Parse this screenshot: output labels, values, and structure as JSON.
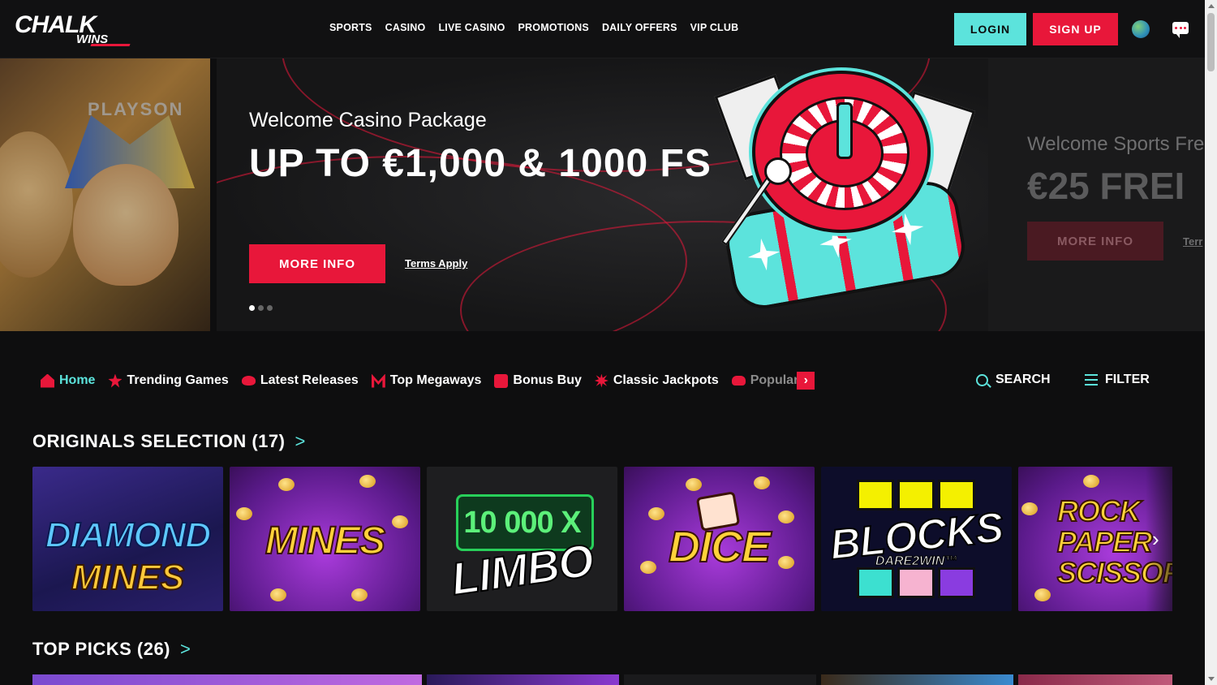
{
  "brand": {
    "logo_main": "CHALK",
    "logo_sub": "WINS"
  },
  "nav": [
    "SPORTS",
    "CASINO",
    "LIVE CASINO",
    "PROMOTIONS",
    "DAILY OFFERS",
    "VIP CLUB"
  ],
  "header": {
    "login": "LOGIN",
    "signup": "SIGN UP"
  },
  "hero_prev": {
    "brand": "PLAYSON"
  },
  "hero": {
    "subtitle": "Welcome Casino Package",
    "headline": "UP TO €1,000 & 1000 FS",
    "button": "MORE INFO",
    "terms": "Terms Apply",
    "slides": 3,
    "active_slide": 1
  },
  "hero_next": {
    "subtitle": "Welcome Sports Fre",
    "headline": "€25 FREI",
    "button": "MORE INFO",
    "terms": "Terr"
  },
  "categories": [
    {
      "label": "Home",
      "icon": "home-icon",
      "active": true
    },
    {
      "label": "Trending Games",
      "icon": "star-icon"
    },
    {
      "label": "Latest Releases",
      "icon": "lips-icon"
    },
    {
      "label": "Top Megaways",
      "icon": "megaways-icon"
    },
    {
      "label": "Bonus Buy",
      "icon": "check-icon"
    },
    {
      "label": "Classic Jackpots",
      "icon": "burst-icon"
    },
    {
      "label": "Popular",
      "icon": "gamepad-icon"
    }
  ],
  "tools": {
    "search": "SEARCH",
    "filter": "FILTER"
  },
  "sections": [
    {
      "title": "ORIGINALS SELECTION (17)",
      "arrow": ">",
      "games": [
        {
          "name": "DIAMOND",
          "name2": "MINES"
        },
        {
          "name": "MINES"
        },
        {
          "name": "LIMBO",
          "multiplier": "10 000 X"
        },
        {
          "name": "DICE"
        },
        {
          "name": "BLOCKS",
          "sub": "DARE2WIN™"
        },
        {
          "name": "ROCK\nPAPER\nSCISSOR"
        }
      ]
    },
    {
      "title": "TOP PICKS (26)",
      "arrow": ">"
    }
  ],
  "colors": {
    "accent_red": "#e8173a",
    "accent_teal": "#5ce3dc",
    "background": "#0e0e0f"
  }
}
